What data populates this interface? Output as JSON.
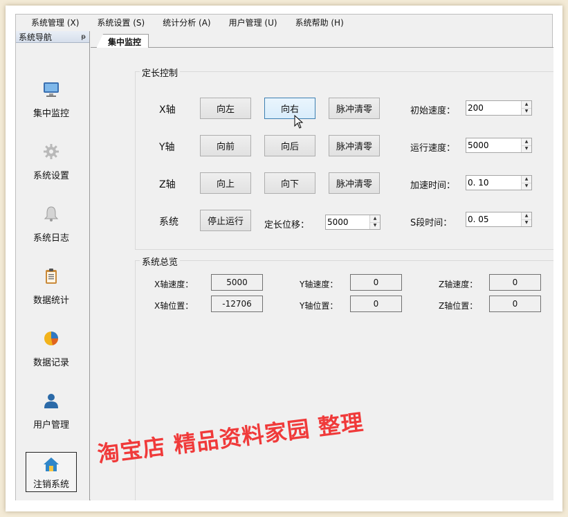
{
  "menu": [
    "系统管理 (X)",
    "系统设置 (S)",
    "统计分析 (A)",
    "用户管理 (U)",
    "系统帮助 (H)"
  ],
  "nav": {
    "title": "系统导航",
    "pin_glyph": "ᵽ",
    "items": [
      {
        "label": "集中监控",
        "icon": "monitor-icon"
      },
      {
        "label": "系统设置",
        "icon": "gear-icon"
      },
      {
        "label": "系统日志",
        "icon": "bell-icon"
      },
      {
        "label": "数据统计",
        "icon": "clipboard-icon"
      },
      {
        "label": "数据记录",
        "icon": "pie-chart-icon"
      },
      {
        "label": "用户管理",
        "icon": "user-icon"
      },
      {
        "label": "注销系统",
        "icon": "home-icon"
      }
    ]
  },
  "tab": {
    "label": "集中监控"
  },
  "control": {
    "title": "定长控制",
    "rows": [
      {
        "label": "X轴",
        "buttons": [
          "向左",
          "向右",
          "脉冲清零"
        ],
        "field_label": "初始速度：",
        "field_value": "200"
      },
      {
        "label": "Y轴",
        "buttons": [
          "向前",
          "向后",
          "脉冲清零"
        ],
        "field_label": "运行速度：",
        "field_value": "5000"
      },
      {
        "label": "Z轴",
        "buttons": [
          "向上",
          "向下",
          "脉冲清零"
        ],
        "field_label": "加速时间：",
        "field_value": "0. 10"
      }
    ],
    "system": {
      "label": "系统",
      "stop_button": "停止运行",
      "length_label": "定长位移：",
      "length_value": "5000",
      "s_label": "S段时间：",
      "s_value": "0. 05"
    }
  },
  "overview": {
    "title": "系统总览",
    "x_speed_label": "X轴速度：",
    "x_speed": "5000",
    "x_pos_label": "X轴位置：",
    "x_pos": "-12706",
    "y_speed_label": "Y轴速度：",
    "y_speed": "0",
    "y_pos_label": "Y轴位置：",
    "y_pos": "0",
    "z_speed_label": "Z轴速度：",
    "z_speed": "0",
    "z_pos_label": "Z轴位置：",
    "z_pos": "0"
  },
  "watermark": "淘宝店 精品资料家园 整理",
  "colors": {
    "accent": "#3c7fb1",
    "watermark": "#f03a3a"
  }
}
